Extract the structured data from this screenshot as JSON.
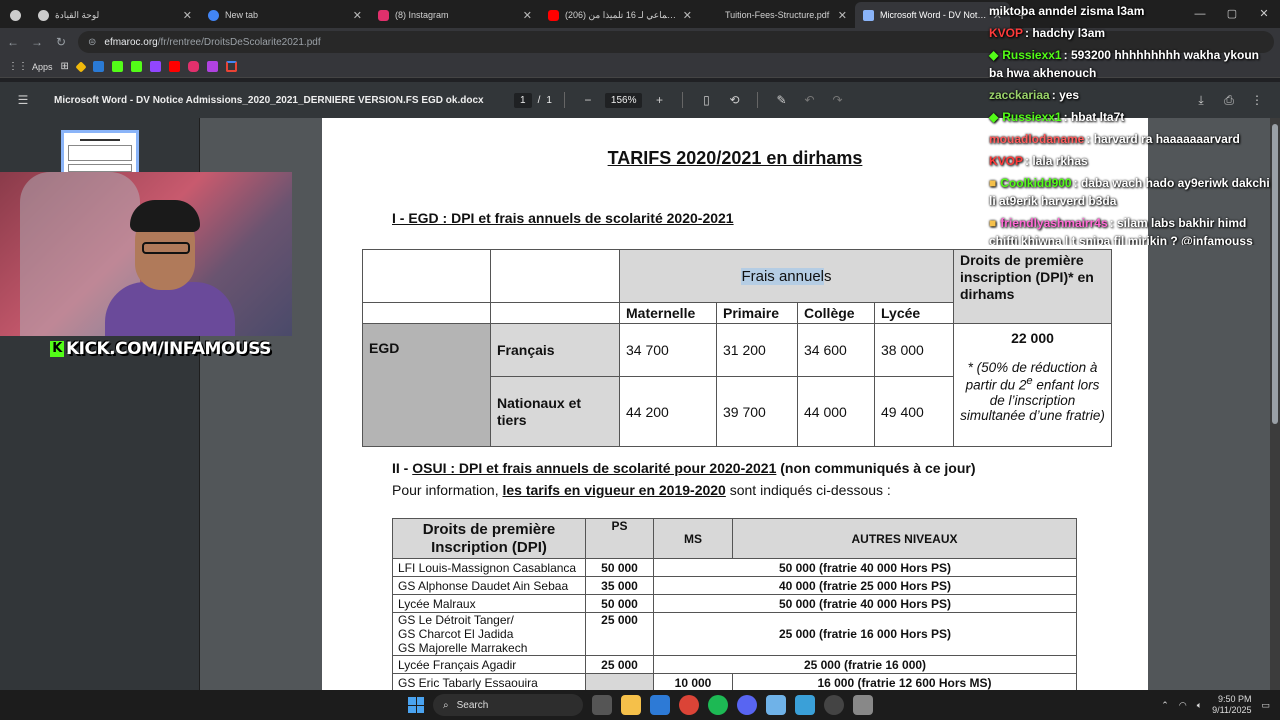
{
  "tabs": [
    {
      "title": "لوحة القيادة",
      "color": "#cccccc"
    },
    {
      "title": "New tab",
      "color": "#4285f4"
    },
    {
      "title": "(8) Instagram",
      "color": "#e1306c"
    },
    {
      "title": "(206) طرد جماعي لـ 16 تلميذا من",
      "color": "#ff0000"
    },
    {
      "title": "Tuition-Fees-Structure.pdf",
      "color": "#e8eaed"
    },
    {
      "title": "Microsoft Word - DV Notice Ad",
      "color": "#e8eaed",
      "active": true
    }
  ],
  "address": {
    "domain": "efmaroc.org",
    "path": "/fr/rentree/DroitsDeScolarite2021.pdf"
  },
  "bookmarks": {
    "apps_label": "Apps"
  },
  "pdf": {
    "title": "Microsoft Word - DV Notice Admissions_2020_2021_DERNIERE VERSION.FS EGD ok.docx",
    "page_current": "1",
    "page_sep": "/",
    "page_total": "1",
    "zoom": "156%"
  },
  "doc": {
    "title": "TARIFS 2020/2021 en dirhams",
    "section1": "I - EGD : DPI et frais annuels de scolarité 2020-2021",
    "t1": {
      "frais_annuels_a": "Frais annuel",
      "frais_annuels_b": "s",
      "dpi_header": "Droits de première inscription (DPI)* en dirhams",
      "cols": [
        "Maternelle",
        "Primaire",
        "Collège",
        "Lycée"
      ],
      "group": "EGD",
      "rows": [
        {
          "label": "Français",
          "values": [
            "34 700",
            "31 200",
            "34 600",
            "38 000"
          ]
        },
        {
          "label": "Nationaux et tiers",
          "values": [
            "44 200",
            "39 700",
            "44 000",
            "49 400"
          ]
        }
      ],
      "dpi_value": "22 000",
      "dpi_note_a": "* (50% de réduction à partir du 2",
      "dpi_note_sup": "e",
      "dpi_note_b": " enfant lors de l’inscription simultanée d’une fratrie)"
    },
    "section2": {
      "prefix": "II - ",
      "title": "OSUI : DPI et frais annuels de scolarité pour 2020-2021",
      "suffix": " (non communiqués à ce jour)",
      "info_prefix": "Pour information, ",
      "info_link": "les tarifs en vigueur en 2019-2020",
      "info_suffix": " sont indiqués ci-dessous :"
    },
    "t2": {
      "headers": [
        "Droits de première Inscription (DPI)",
        "PS",
        "MS",
        "AUTRES NIVEAUX"
      ],
      "rows": [
        {
          "name": "LFI Louis-Massignon Casablanca",
          "ps": "50 000",
          "rest": "50 000 (fratrie 40 000 Hors PS)"
        },
        {
          "name": "GS Alphonse Daudet Ain Sebaa",
          "ps": "35 000",
          "rest": "40 000 (fratrie 25 000 Hors PS)"
        },
        {
          "name": "Lycée Malraux",
          "ps": "50 000",
          "rest": "50 000 (fratrie 40 000 Hors PS)"
        },
        {
          "name": "GS Le Détroit Tanger/\nGS Charcot El Jadida\nGS Majorelle Marrakech",
          "ps": "25 000",
          "rest": "25 000 (fratrie 16 000 Hors PS)"
        },
        {
          "name": "Lycée Français Agadir",
          "ps": "25 000",
          "rest": "25 000 (fratrie 16 000)"
        },
        {
          "name": "GS Eric Tabarly Essaouira",
          "ps": "",
          "ms": "10 000",
          "rest": "16 000 (fratrie 12 600  Hors MS)"
        }
      ]
    }
  },
  "stream": {
    "kick_url": "KICK.COM/INFAMOUSS"
  },
  "chat": [
    {
      "user": "miktoba anndel zisma l3am",
      "text": "",
      "color": "#ffffff"
    },
    {
      "user": "KVOP",
      "text": ": hadchy l3am",
      "color": "#ff3b3b"
    },
    {
      "user": "Russiexx1",
      "text": ": 593200 hhhhhhhhh wakha ykoun ba hwa akhenouch",
      "color": "#53fc18",
      "badge": "diamond"
    },
    {
      "user": "zacckariaa",
      "text": ": yes",
      "color": "#9ad36a"
    },
    {
      "user": "Russiexx1",
      "text": ": hbat lta7t",
      "color": "#53fc18",
      "badge": "diamond"
    },
    {
      "user": "mouadlodaname",
      "text": ": harvard ra haaaaaaarvard",
      "color": "#ff5c5c"
    },
    {
      "user": "KVOP",
      "text": ": lala rkhas",
      "color": "#ff3b3b"
    },
    {
      "user": "Coolkidd900",
      "text": ": daba wach hado ay9eriwk dakchi li at9erik harverd b3da",
      "color": "#53fc18",
      "badge": "box"
    },
    {
      "user": "friendlyashmairr4s",
      "text": ": silam labs bakhir himd chifti khiwna l t snipa fil mirikin ? @infamouss",
      "color": "#ff6ad5",
      "badge": "box"
    }
  ],
  "taskbar": {
    "search_label": "Search",
    "time": "9:50 PM",
    "date": "9/11/2025"
  },
  "colors": {
    "accent": "#8ab4f8",
    "kick_green": "#53fc18",
    "highlight": "#b5cde4"
  }
}
